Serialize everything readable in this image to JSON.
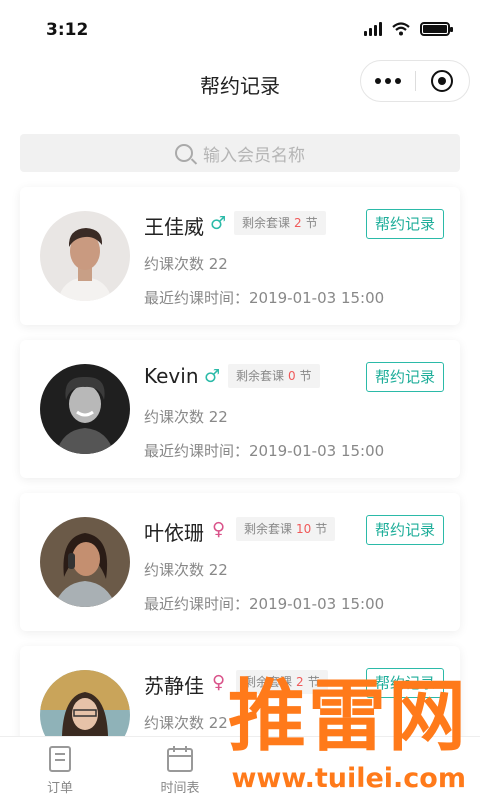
{
  "status_bar": {
    "time": "3:12"
  },
  "nav": {
    "title": "帮约记录"
  },
  "search": {
    "placeholder": "输入会员名称"
  },
  "members": [
    {
      "name": "王佳威",
      "gender_symbol": "♂",
      "gender": "male",
      "package_prefix": "剩余套课",
      "package_count": "2",
      "package_suffix": "节",
      "action": "帮约记录",
      "count_text": "约课次数 22",
      "last_text": "最近约课时间：2019-01-03   15:00"
    },
    {
      "name": "Kevin",
      "gender_symbol": "♂",
      "gender": "male",
      "package_prefix": "剩余套课",
      "package_count": "0",
      "package_suffix": "节",
      "action": "帮约记录",
      "count_text": "约课次数 22",
      "last_text": "最近约课时间：2019-01-03   15:00"
    },
    {
      "name": "叶依珊",
      "gender_symbol": "♀",
      "gender": "female",
      "package_prefix": "剩余套课",
      "package_count": "10",
      "package_suffix": "节",
      "action": "帮约记录",
      "count_text": "约课次数 22",
      "last_text": "最近约课时间：2019-01-03   15:00"
    },
    {
      "name": "苏静佳",
      "gender_symbol": "♀",
      "gender": "female",
      "package_prefix": "剩余套课",
      "package_count": "2",
      "package_suffix": "节",
      "action": "帮约记录",
      "count_text": "约课次数 22",
      "last_text": ""
    }
  ],
  "tabs": [
    {
      "label": "订单",
      "icon": "order-icon"
    },
    {
      "label": "时间表",
      "icon": "calendar-icon"
    }
  ],
  "watermark": {
    "brand": "推雷网",
    "url": "www.tuilei.com"
  },
  "colors": {
    "accent": "#1fae9a",
    "male": "#2bbaa8",
    "female": "#d9538a",
    "count_red": "#f05a5a",
    "watermark": "#ff7a1a"
  }
}
